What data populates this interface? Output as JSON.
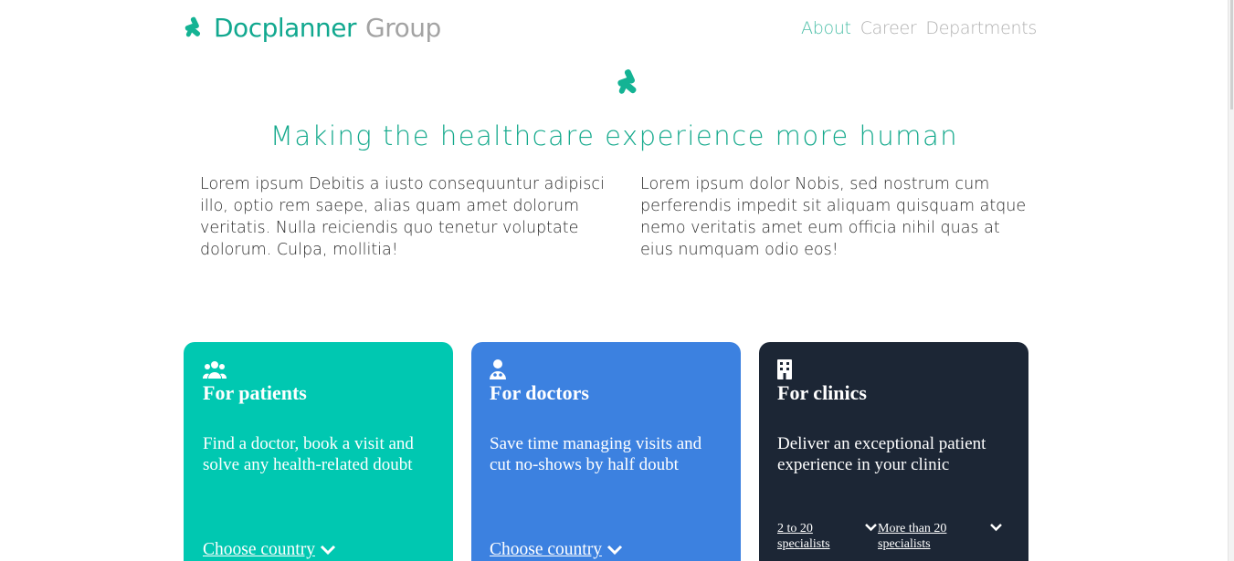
{
  "header": {
    "brand_name": "Docplanner",
    "brand_group": "Group",
    "brand_icon": "docplanner-logo-icon",
    "brand_color": "#11a88f",
    "nav": [
      {
        "label": "About",
        "active": true
      },
      {
        "label": "Career",
        "active": false
      },
      {
        "label": "Departments",
        "active": false
      }
    ]
  },
  "hero": {
    "icon": "docplanner-logo-icon",
    "title": "Making the healthcare experience more human",
    "intro_left": "Lorem ipsum Debitis a iusto consequuntur adipisci illo, optio rem saepe, alias quam amet dolorum veritatis. Nulla reiciendis quo tenetur voluptate dolorum. Culpa, mollitia!",
    "intro_right": "Lorem ipsum dolor Nobis, sed nostrum cum perferendis impedit sit aliquam quisquam atque nemo veritatis amet eum officia nihil quas at eius numquam odio eos!"
  },
  "cards": {
    "patients": {
      "icon": "users-icon",
      "title": "For patients",
      "description": "Find a doctor, book a visit and solve any health-related doubt",
      "link": "Choose country",
      "color": "#00c8b1"
    },
    "doctors": {
      "icon": "doctor-icon",
      "title": "For doctors",
      "description": "Save time managing visits and cut no-shows by half doubt",
      "link": "Choose country",
      "color": "#3c81e0"
    },
    "clinics": {
      "icon": "building-icon",
      "title": "For clinics",
      "description": "Deliver an exceptional patient experience in your clinic",
      "options": [
        "2 to 20 specialists",
        "More than 20 specialists"
      ],
      "color": "#1c2635"
    }
  }
}
